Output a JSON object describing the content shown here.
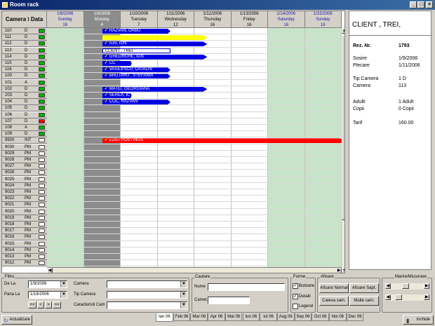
{
  "window": {
    "title": "Room rack",
    "buttons": [
      "_",
      "□",
      "×"
    ]
  },
  "grid": {
    "header_left": "Camera \\ Data",
    "days": [
      {
        "date": "1/8/2006",
        "weekday": "Sunday",
        "num": "16",
        "weekend": true
      },
      {
        "date": "1/9/2006",
        "weekday": "Monday",
        "num": "4",
        "selected": true
      },
      {
        "date": "1/10/2006",
        "weekday": "Tuesday",
        "num": "7"
      },
      {
        "date": "1/11/2006",
        "weekday": "Wednesday",
        "num": "12"
      },
      {
        "date": "1/12/2006",
        "weekday": "Thursday",
        "num": "16"
      },
      {
        "date": "1/13/2006",
        "weekday": "Friday",
        "num": "16"
      },
      {
        "date": "1/14/2006",
        "weekday": "Saturday",
        "num": "16",
        "weekend": true
      },
      {
        "date": "1/15/2006",
        "weekday": "Sunday",
        "num": "16",
        "weekend": true
      }
    ],
    "rooms": [
      {
        "num": "110",
        "type": "D",
        "status": "green"
      },
      {
        "num": "111",
        "type": "D",
        "status": "green"
      },
      {
        "num": "112",
        "type": "D",
        "status": "green"
      },
      {
        "num": "113",
        "type": "D",
        "status": "green"
      },
      {
        "num": "114",
        "type": "D",
        "status": "green"
      },
      {
        "num": "115",
        "type": "D",
        "status": "green"
      },
      {
        "num": "116",
        "type": "D",
        "status": "green"
      },
      {
        "num": "100",
        "type": "D",
        "status": "green"
      },
      {
        "num": "101",
        "type": "A",
        "status": "green"
      },
      {
        "num": "102",
        "type": "D",
        "status": "green"
      },
      {
        "num": "203",
        "type": "D",
        "status": "green"
      },
      {
        "num": "104",
        "type": "D",
        "status": "green"
      },
      {
        "num": "105",
        "type": "D",
        "status": "green"
      },
      {
        "num": "106",
        "type": "D",
        "status": "green"
      },
      {
        "num": "107",
        "type": "D",
        "status": "red"
      },
      {
        "num": "108",
        "type": "A",
        "status": "green"
      },
      {
        "num": "109",
        "type": "D",
        "status": "green"
      },
      {
        "num": "9500",
        "type": "INT",
        "status": "white"
      },
      {
        "num": "9030",
        "type": "PM",
        "status": "white"
      },
      {
        "num": "9029",
        "type": "PM",
        "status": "white"
      },
      {
        "num": "9028",
        "type": "PM",
        "status": "white"
      },
      {
        "num": "9027",
        "type": "PM",
        "status": "white"
      },
      {
        "num": "9026",
        "type": "PM",
        "status": "white"
      },
      {
        "num": "9025",
        "type": "PM",
        "status": "white"
      },
      {
        "num": "9024",
        "type": "PM",
        "status": "white"
      },
      {
        "num": "9023",
        "type": "PM",
        "status": "white"
      },
      {
        "num": "9022",
        "type": "PM",
        "status": "white"
      },
      {
        "num": "9021",
        "type": "PM",
        "status": "white"
      },
      {
        "num": "9020",
        "type": "PM",
        "status": "white"
      },
      {
        "num": "9019",
        "type": "PM",
        "status": "white"
      },
      {
        "num": "9018",
        "type": "PM",
        "status": "white"
      },
      {
        "num": "9017",
        "type": "PM",
        "status": "white"
      },
      {
        "num": "9016",
        "type": "PM",
        "status": "white"
      },
      {
        "num": "9015",
        "type": "PM",
        "status": "white"
      },
      {
        "num": "9014",
        "type": "PM",
        "status": "white"
      },
      {
        "num": "9013",
        "type": "PM",
        "status": "white"
      },
      {
        "num": "9012",
        "type": "PM",
        "status": "white"
      }
    ],
    "bookings": [
      {
        "row": 0,
        "start": 1.5,
        "end": 3.35,
        "label": "RAZVAN, ORBU",
        "color": "#0000e0"
      },
      {
        "row": 1,
        "start": 1.5,
        "end": 4.35,
        "label": "",
        "color": "#ffff00"
      },
      {
        "row": 2,
        "start": 1.5,
        "end": 4.35,
        "label": "ION, ION",
        "color": "#0000e0"
      },
      {
        "row": 3,
        "start": 1.5,
        "end": 3.35,
        "label": "CLIENT , TREI",
        "color": "#0000e0",
        "selected": true
      },
      {
        "row": 4,
        "start": 1.5,
        "end": 4.35,
        "label": "GHEORGHE, ION",
        "color": "#0000e0"
      },
      {
        "row": 5,
        "start": 1.5,
        "end": 2.3,
        "label": "CC",
        "color": "#0000e0"
      },
      {
        "row": 6,
        "start": 1.5,
        "end": 3.35,
        "label": "VASILESCU, CATALIN",
        "color": "#0000e0"
      },
      {
        "row": 7,
        "start": 1.5,
        "end": 3.35,
        "label": "BRUTARU , STEFANIA",
        "color": "#0000e0"
      },
      {
        "row": 9,
        "start": 1.5,
        "end": 4.35,
        "label": "MATEI, GEORGIANA",
        "color": "#0000e0"
      },
      {
        "row": 10,
        "start": 1.5,
        "end": 2.3,
        "label": "SEREA, IC",
        "color": "#0000e0"
      },
      {
        "row": 11,
        "start": 1.5,
        "end": 3.35,
        "label": "COC, RAZVAN",
        "color": "#0000e0"
      },
      {
        "row": 17,
        "start": 1.5,
        "end": 8.2,
        "label": "LOST POSTINGS",
        "color": "#ff0000"
      }
    ]
  },
  "details": {
    "client": "CLIENT , TREI,",
    "rez_label": "Rez. Nr.",
    "rez_value": "1793",
    "sosire_label": "Sosire",
    "sosire_value": "1/9/2006",
    "plecare_label": "Plecare",
    "plecare_value": "1/11/2006",
    "tip_label": "Tip Camera",
    "tip_value": "1 D",
    "camera_label": "Camera",
    "camera_value": "113",
    "adulti_label": "Adulti",
    "adulti_value": "1 Adult",
    "copii_label": "Copii",
    "copii_value": "0 Copii",
    "tarif_label": "Tarif",
    "tarif_value": "160.00"
  },
  "filtru": {
    "title": "Filtru",
    "de_la_label": "De La",
    "de_la_value": "1/9/2006",
    "pana_la_label": "Pana La",
    "pana_la_value": "1/16/2006",
    "nav": [
      "<<",
      "<",
      ">",
      ">>"
    ],
    "camera_label": "Camera",
    "camera_value": "",
    "tip_camera_label": "Tip Camera",
    "tip_camera_value": "",
    "caracteristici_label": "Caracteristi Cam",
    "caracteristici_value": ""
  },
  "cautare": {
    "title": "Cautare",
    "nume_label": "Nume",
    "nume_value": "",
    "camera_label": "Camer.",
    "camera_value": ""
  },
  "forme": {
    "title": "Forme",
    "butoane_label": "Butoane",
    "butoane_checked": true,
    "detalii_label": "Detalii",
    "detalii_checked": true,
    "legend_label": "Legend",
    "legend_checked": false
  },
  "afisare": {
    "title": "Afisare",
    "normal": "Afisare Normal",
    "sapt": "Afisare Sapt.",
    "cateva": "Cateva cam.",
    "multe": "Multe cam."
  },
  "zoom": {
    "title": "Marire/Micsorare"
  },
  "footer": {
    "actualizare": "Actualizare",
    "inchide": "Inchide",
    "months": [
      "Ian 06",
      "Feb 06",
      "Mar 06",
      "Apr 06",
      "Mai 06",
      "Iun 06",
      "Iul 06",
      "Aug 06",
      "Sep 06",
      "Oct 06",
      "Noi 06",
      "Dec 06"
    ],
    "active_month": 0
  }
}
